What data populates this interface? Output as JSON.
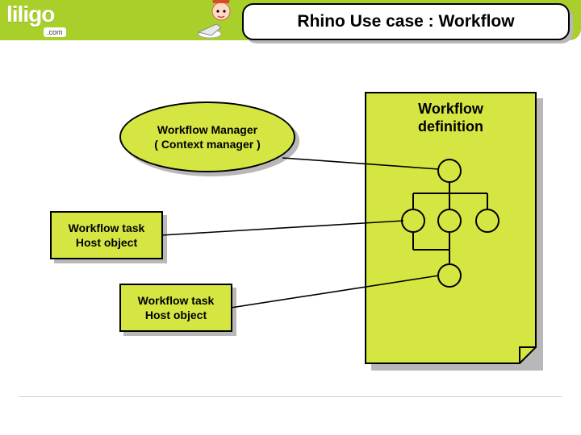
{
  "header": {
    "logo_text": "liligo",
    "logo_sub": ".com",
    "title": "Rhino Use case : Workflow"
  },
  "nodes": {
    "manager": {
      "line1": "Workflow Manager",
      "line2": "( Context manager )"
    },
    "task1": {
      "line1": "Workflow task",
      "line2": "Host object"
    },
    "task2": {
      "line1": "Workflow task",
      "line2": "Host object"
    }
  },
  "sheet": {
    "title_line1": "Workflow",
    "title_line2": "definition"
  },
  "colors": {
    "header_green": "#a9cf2b",
    "node_fill": "#d5e643",
    "shadow": "#b8b8b8"
  }
}
